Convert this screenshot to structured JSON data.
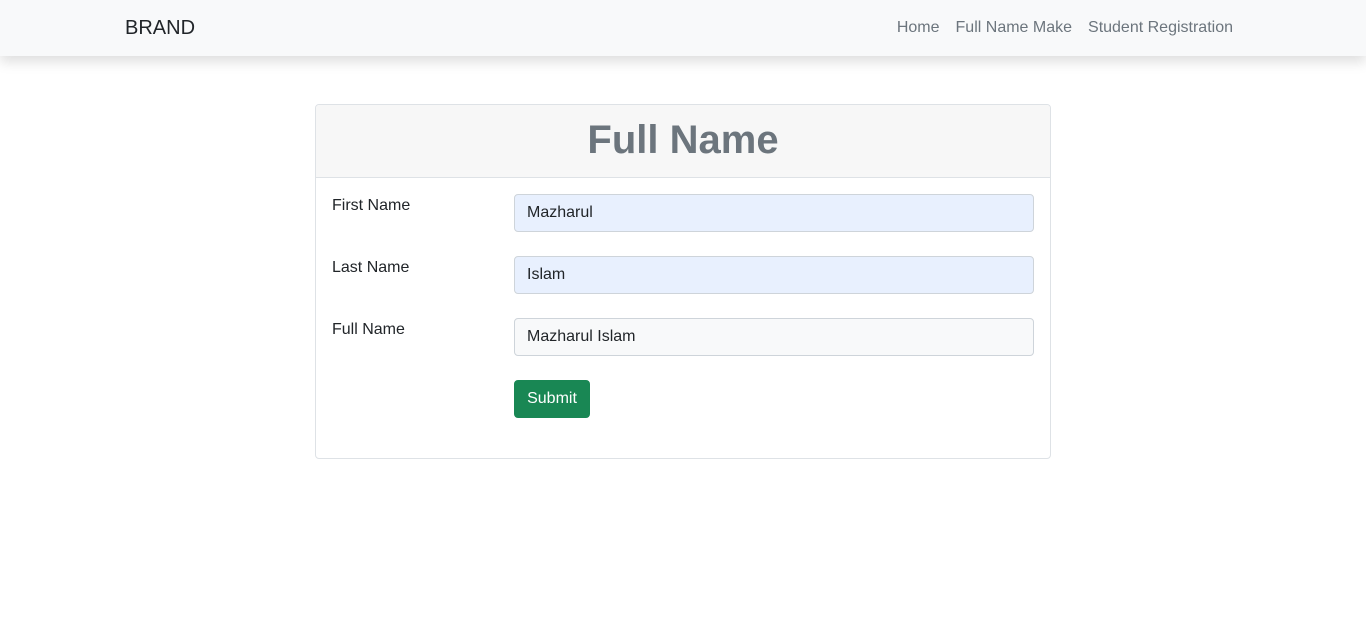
{
  "navbar": {
    "brand": "BRAND",
    "links": [
      "Home",
      "Full Name Make",
      "Student Registration"
    ]
  },
  "card": {
    "title": "Full Name",
    "fields": [
      {
        "label": "First Name",
        "value": "Mazharul"
      },
      {
        "label": "Last Name",
        "value": "Islam"
      },
      {
        "label": "Full Name",
        "value": "Mazharul Islam"
      }
    ],
    "submit_label": "Submit"
  },
  "colors": {
    "navbar_bg": "#f8f9fa",
    "submit_bg": "#198754",
    "autofill_bg": "#e8f0fe",
    "title_color": "#6c757d"
  }
}
